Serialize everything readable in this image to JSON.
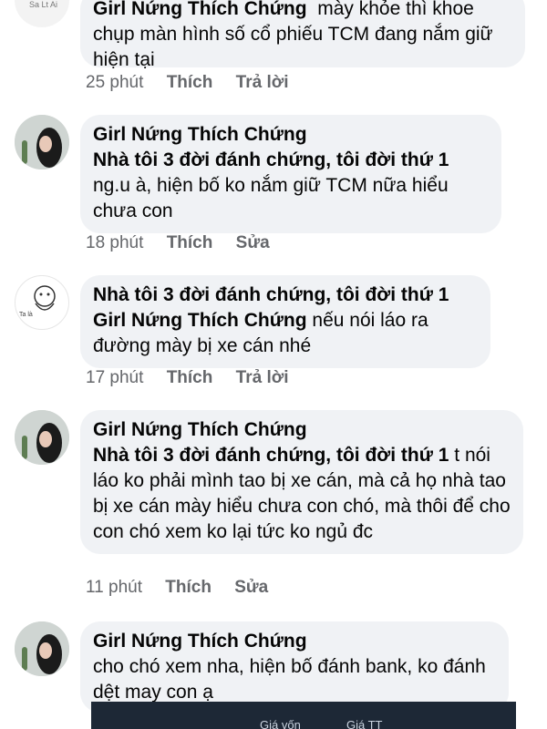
{
  "comments": [
    {
      "author": "",
      "lines_top": "Girl Nứng Thích Chứng  mày khỏe thì khoe",
      "text": "chụp màn hình số cổ phiếu TCM đang nắm giữ hiện tại",
      "time": "25 phút",
      "like": "Thích",
      "action": "Trả lời"
    },
    {
      "author": "Girl Nứng Thích Chứng",
      "mention": "Nhà tôi 3 đời đánh chứng, tôi đời thứ 1",
      "text": "ng.u à, hiện bố ko nắm giữ TCM nữa hiểu chưa con",
      "time": "18 phút",
      "like": "Thích",
      "action": "Sửa"
    },
    {
      "author": "Nhà tôi 3 đời đánh chứng, tôi đời thứ 1",
      "mention": "Girl Nứng Thích Chứng",
      "text": "nếu nói láo ra đường mày bị xe cán nhé",
      "time": "17 phút",
      "like": "Thích",
      "action": "Trả lời"
    },
    {
      "author": "Girl Nứng Thích Chứng",
      "mention": "Nhà tôi 3 đời đánh chứng, tôi đời thứ 1",
      "text": "t nói láo ko phải mình tao bị xe cán, mà cả họ nhà tao bị xe cán mày hiểu chưa con chó, mà thôi để cho con chó xem ko lại tức ko ngủ đc",
      "time": "11 phút",
      "like": "Thích",
      "action": "Sửa"
    },
    {
      "author": "Girl Nứng Thích Chứng",
      "text": "cho chó xem nha, hiện bố đánh bank, ko đánh dệt may con ạ"
    }
  ],
  "avatar2_caption": "Ta là",
  "photo_labels": [
    "Giá vốn",
    "Giá TT"
  ]
}
